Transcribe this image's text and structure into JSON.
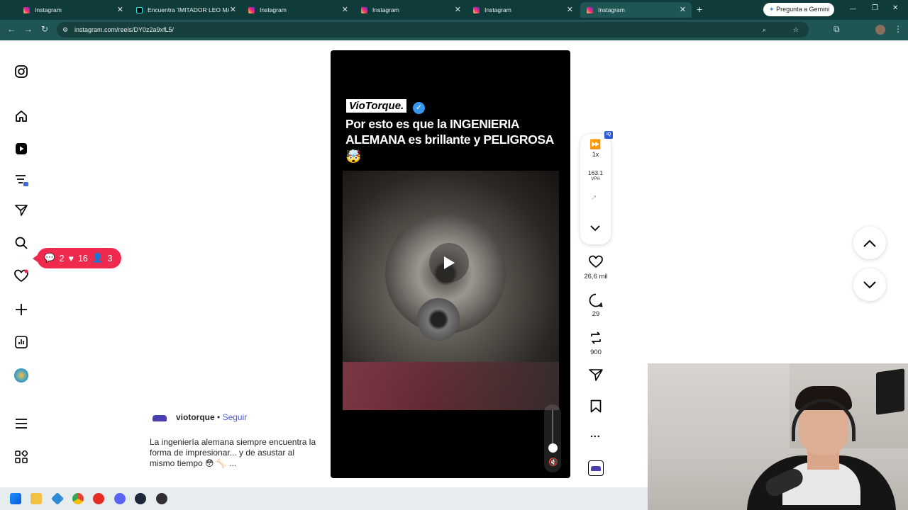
{
  "browser": {
    "tabs": [
      {
        "title": "Instagram",
        "active": false,
        "favicon": "instagram-icon"
      },
      {
        "title": "Encuentra 'IMITADOR LEO MA",
        "active": false,
        "favicon": "tiktok-icon"
      },
      {
        "title": "Instagram",
        "active": false,
        "favicon": "instagram-icon"
      },
      {
        "title": "Instagram",
        "active": false,
        "favicon": "instagram-icon"
      },
      {
        "title": "Instagram",
        "active": false,
        "favicon": "instagram-icon"
      },
      {
        "title": "Instagram",
        "active": true,
        "favicon": "instagram-icon"
      }
    ],
    "new_tab_symbol": "+",
    "gemini_label": "Pregunta a Gemini",
    "url": "instagram.com/reels/DY0z2a9xfL5/",
    "window_controls": {
      "minimize": "—",
      "restore": "❐",
      "close": "✕"
    }
  },
  "notifications": {
    "comments": "2",
    "likes": "16",
    "follows": "3"
  },
  "reel": {
    "brand": "VioTorque.",
    "headline": "Por esto es que la INGENIERIA ALEMANA es brillante y PELIGROSA",
    "emoji": "🤯"
  },
  "extension": {
    "badge": "IQ",
    "speed": "1x",
    "vph_value": "163.1",
    "vph_label": "VPH"
  },
  "actions": {
    "likes": "26,6 mil",
    "comments": "29",
    "reposts": "900",
    "more": "..."
  },
  "author": {
    "username": "viotorque",
    "separator": "•",
    "follow_label": "Seguir"
  },
  "caption": {
    "text": "La ingeniería alemana siempre encuentra la forma de impresionar... y de asustar al mismo tiempo 😳 🦴 ..."
  },
  "colors": {
    "accent": "#4f5bd5",
    "notification": "#ef2a4f",
    "chrome": "#1f5553"
  }
}
